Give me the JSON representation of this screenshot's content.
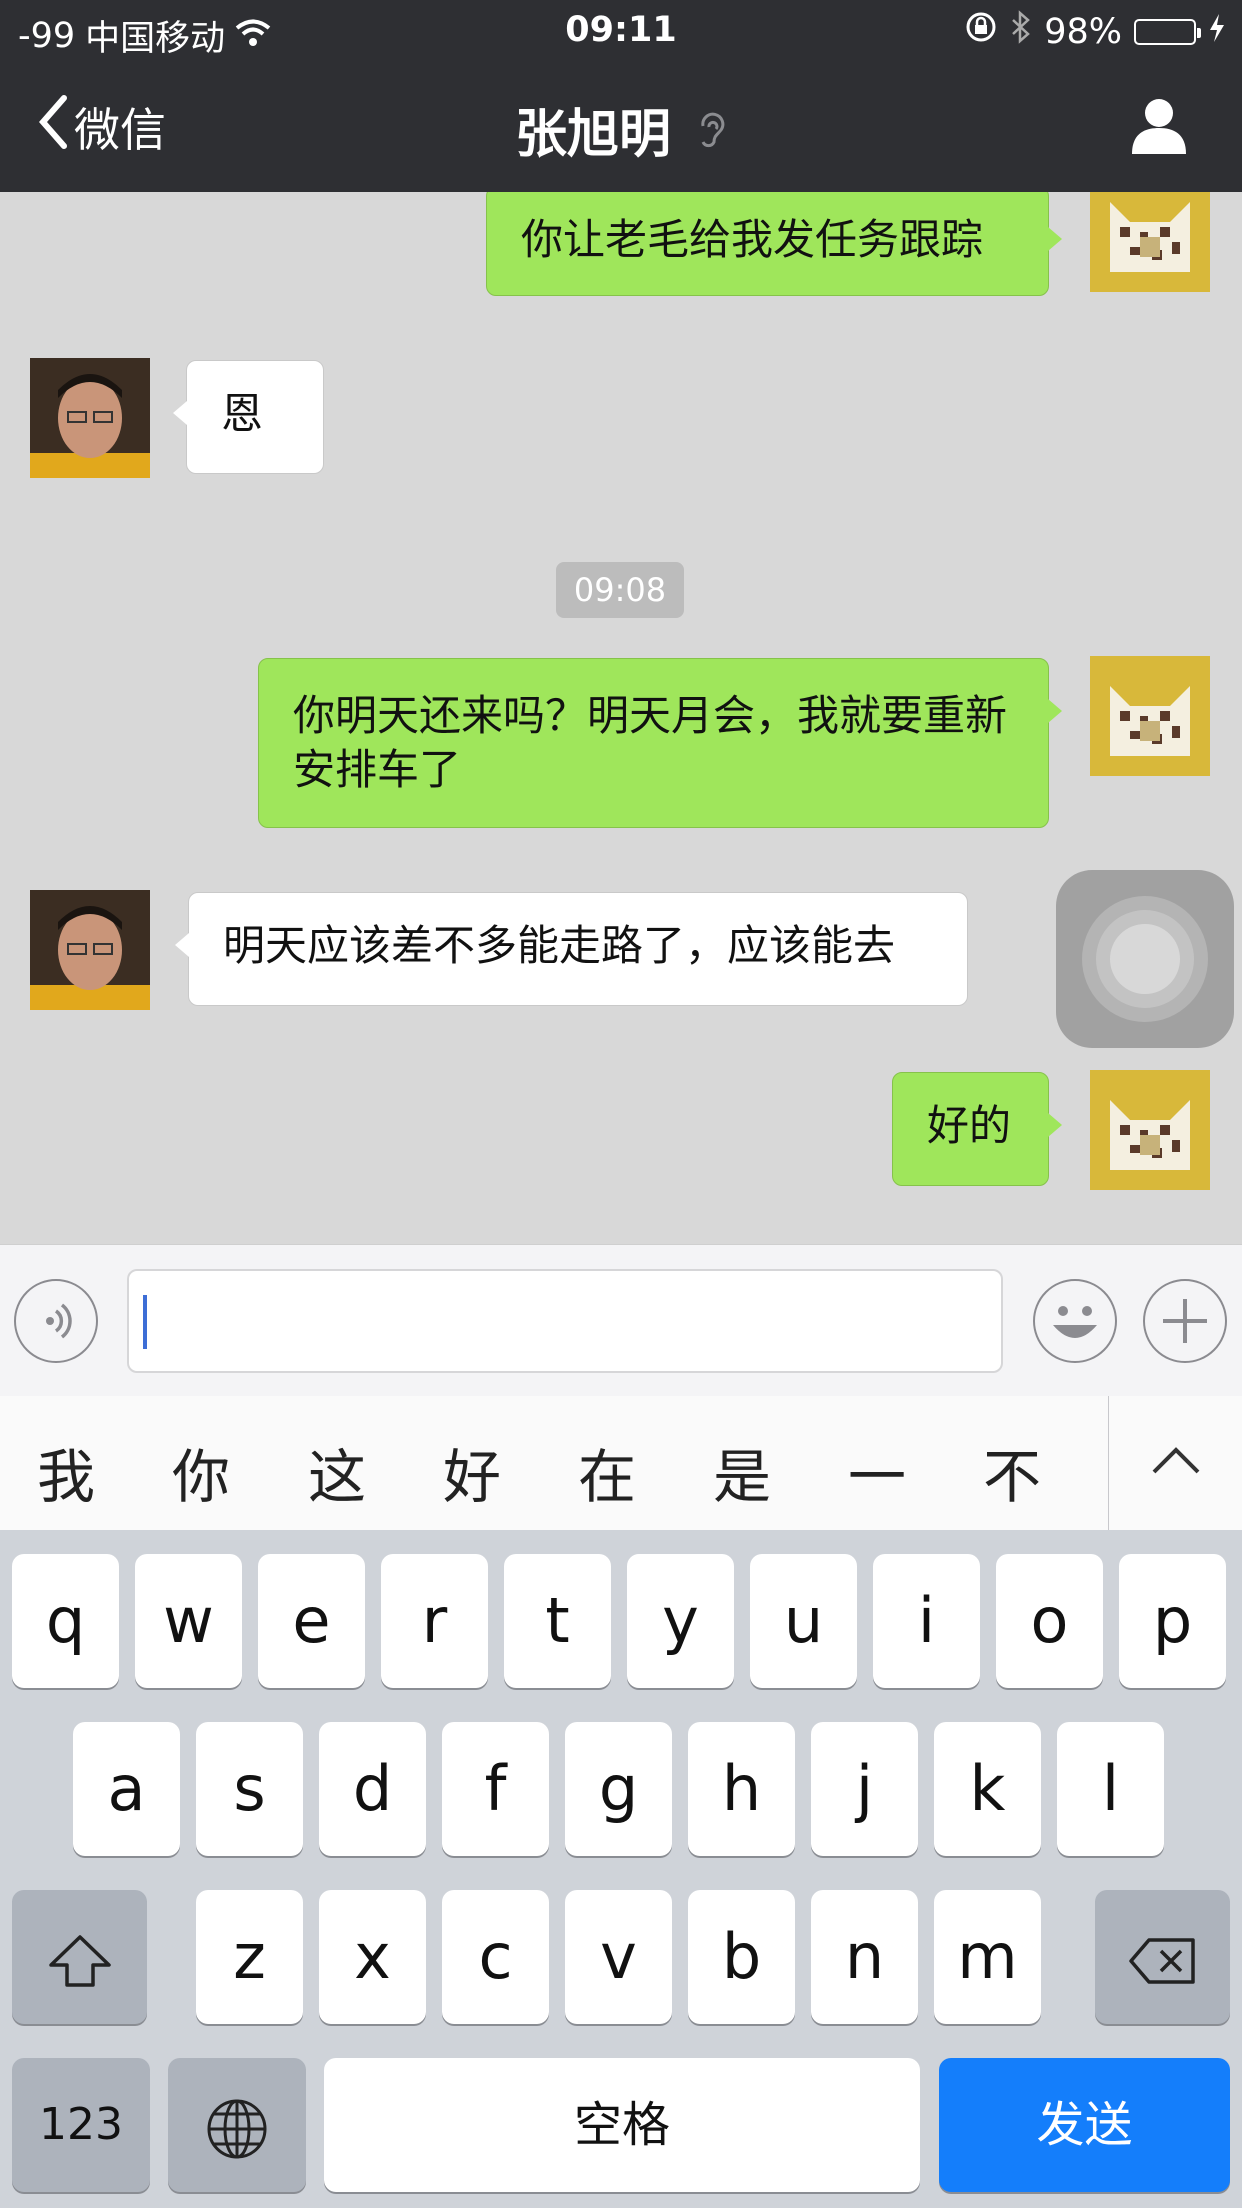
{
  "status_bar": {
    "signal": "-99",
    "carrier": "中国移动",
    "time": "09:11",
    "battery": "98%"
  },
  "nav": {
    "back_label": "微信",
    "title": "张旭明"
  },
  "chat": {
    "timestamp": "09:08",
    "messages": [
      {
        "from": "me",
        "text": "你让老毛给我发任务跟踪"
      },
      {
        "from": "them",
        "text": "恩"
      },
      {
        "from": "me",
        "text": "你明天还来吗？明天月会，我就要重新安排车了"
      },
      {
        "from": "them",
        "text": "明天应该差不多能走路了，应该能去"
      },
      {
        "from": "me",
        "text": "好的"
      }
    ]
  },
  "input": {
    "value": ""
  },
  "candidates": [
    "我",
    "你",
    "这",
    "好",
    "在",
    "是",
    "一",
    "不"
  ],
  "keyboard": {
    "row1": [
      "q",
      "w",
      "e",
      "r",
      "t",
      "y",
      "u",
      "i",
      "o",
      "p"
    ],
    "row2": [
      "a",
      "s",
      "d",
      "f",
      "g",
      "h",
      "j",
      "k",
      "l"
    ],
    "row3": [
      "z",
      "x",
      "c",
      "v",
      "b",
      "n",
      "m"
    ],
    "num_label": "123",
    "space_label": "空格",
    "send_label": "发送"
  },
  "colors": {
    "accent_send": "#147efb",
    "bubble_me": "#9fe65b",
    "nav_bg": "#2e2f33"
  }
}
